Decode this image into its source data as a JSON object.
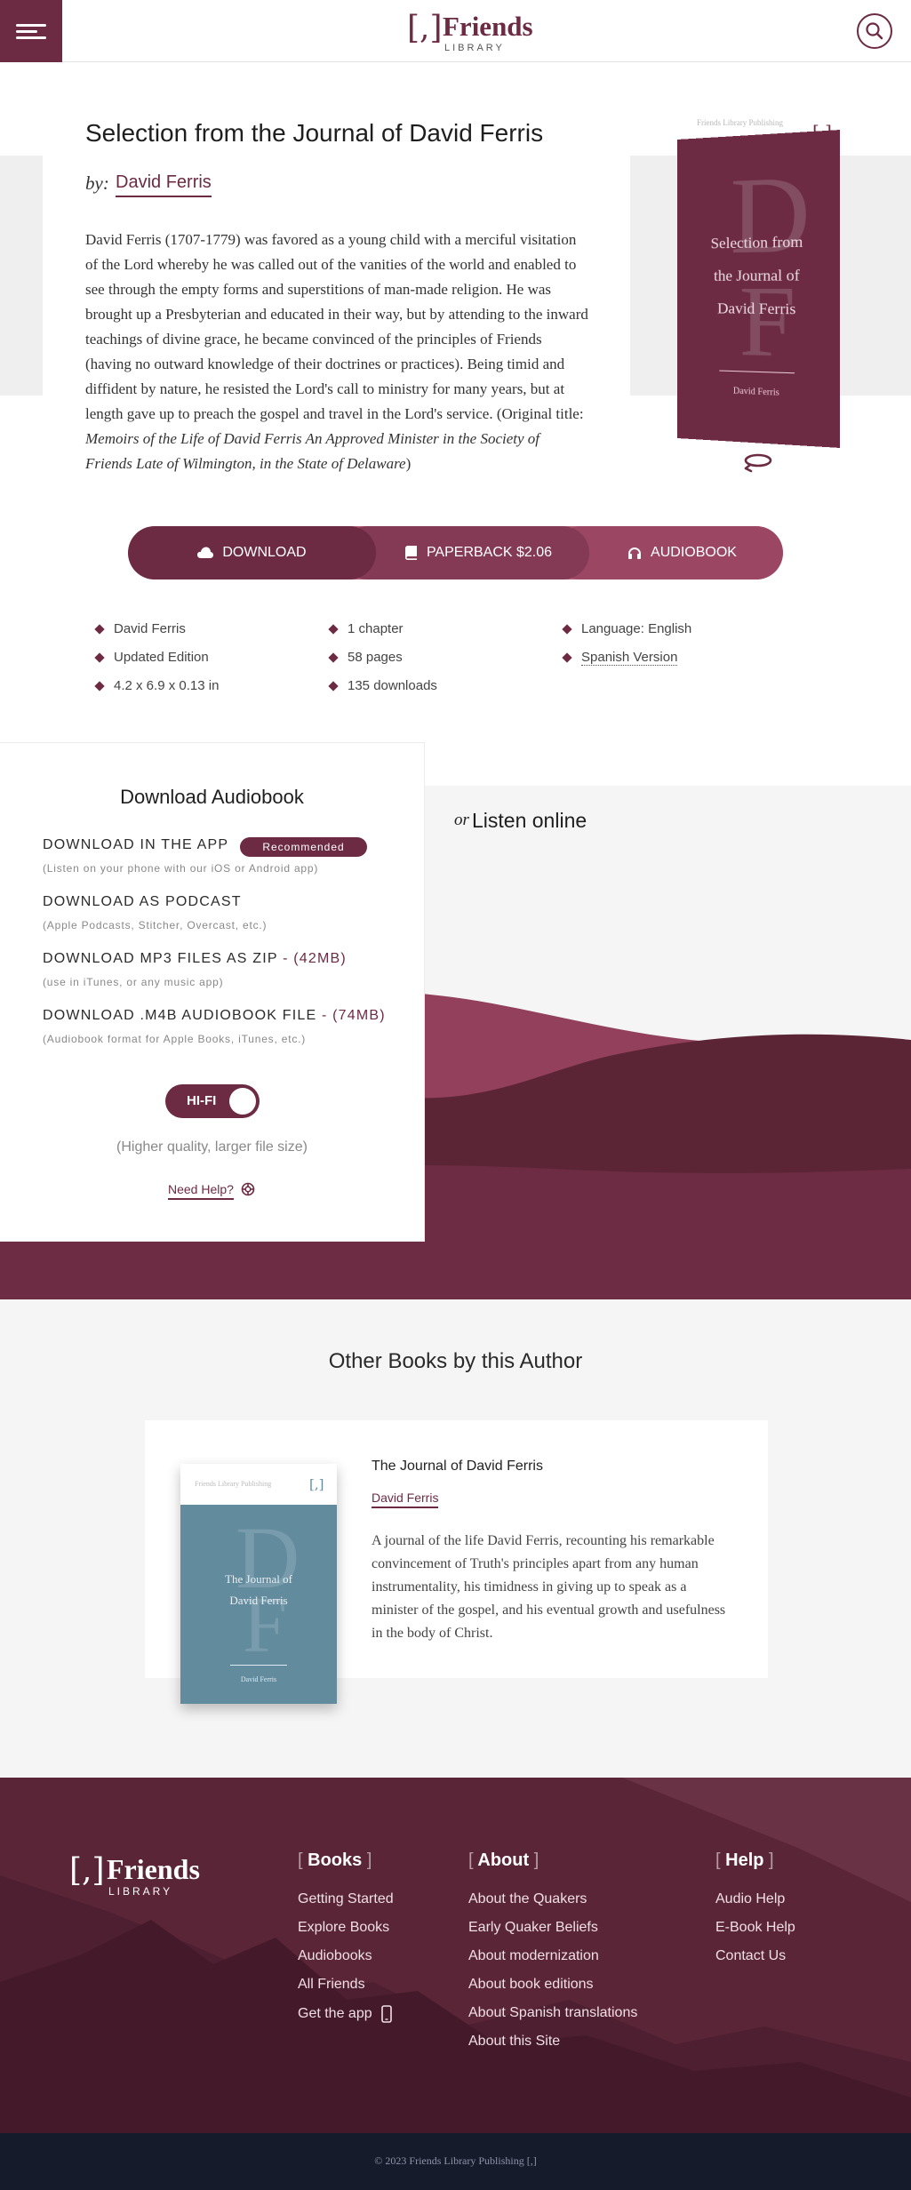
{
  "header": {
    "logo_bracket": "[,]",
    "logo_name": "Friends",
    "logo_sub": "LIBRARY",
    "menu_icon": "hamburger-menu-icon",
    "search_icon": "search-icon"
  },
  "book": {
    "title": "Selection from the Journal of David Ferris",
    "by_label": "by:",
    "author": "David Ferris",
    "description": "David Ferris (1707-1779) was favored as a young child with a merciful visitation of the Lord whereby he was called out of the vanities of the world and enabled to see through the empty forms and superstitions of man-made religion. He was brought up a Presbyterian and educated in their way, but by attending to the inward teachings of divine grace, he became convinced of the principles of Friends (having no outward knowledge of their doctrines or practices). Being timid and diffident by nature, he resisted the Lord's call to ministry for many years, but at length gave up to preach the gospel and travel in the Lord's service. (Original title: ",
    "original_title": "Memoirs of the Life of David Ferris An Approved Minister in the Society of Friends Late of Wilmington, in the State of Delaware",
    "description_end": ")",
    "cover": {
      "publisher": "Friends Library Publishing",
      "logo": "[,]",
      "monogram_1": "D",
      "monogram_2": "F",
      "title_line_1": "Selection from",
      "title_line_2": "the Journal of",
      "title_line_3": "David Ferris",
      "author": "David Ferris",
      "color": "#6c2b43"
    }
  },
  "actions": {
    "download": "DOWNLOAD",
    "paperback": "PAPERBACK $2.06",
    "audiobook": "AUDIOBOOK"
  },
  "meta": {
    "col1": [
      "David Ferris",
      "Updated Edition",
      "4.2 x 6.9 x 0.13 in"
    ],
    "col2": [
      "1 chapter",
      "58 pages",
      "135 downloads"
    ],
    "col3": [
      "Language: English",
      "Spanish Version"
    ]
  },
  "audio": {
    "title": "Download Audiobook",
    "options": [
      {
        "label": "DOWNLOAD IN THE APP",
        "size": "",
        "sub": "(Listen on your phone with our iOS or Android app)"
      },
      {
        "label": "DOWNLOAD AS PODCAST",
        "size": "",
        "sub": "(Apple Podcasts, Stitcher, Overcast, etc.)"
      },
      {
        "label": "DOWNLOAD MP3 FILES AS ZIP",
        "size": "- (42MB)",
        "sub": "(use in iTunes, or any music app)"
      },
      {
        "label": "DOWNLOAD .M4B AUDIOBOOK FILE",
        "size": "- (74MB)",
        "sub": "(Audiobook format for Apple Books, iTunes, etc.)"
      }
    ],
    "recommended": "Recommended",
    "hifi_label": "HI-FI",
    "hifi_note": "(Higher quality, larger file size)",
    "need_help": "Need Help?",
    "listen_or": "or",
    "listen_title": "Listen online"
  },
  "other_books": {
    "heading": "Other Books by this Author",
    "book": {
      "title": "The Journal of David Ferris",
      "author": "David Ferris",
      "description": "A journal of the life David Ferris, recounting his remarkable convincement of Truth's principles apart from any human instrumentality, his timidness in giving up to speak as a minister of the gospel, and his eventual growth and usefulness in the body of Christ.",
      "cover": {
        "publisher": "Friends Library Publishing",
        "logo": "[,]",
        "monogram_1": "D",
        "monogram_2": "F",
        "title_line_1": "The Journal of",
        "title_line_2": "David Ferris",
        "author": "David Ferris",
        "color": "#628b9e"
      }
    }
  },
  "footer": {
    "logo_bracket": "[,]",
    "logo_name": "Friends",
    "logo_sub": "LIBRARY",
    "books_heading": "Books",
    "books": [
      "Getting Started",
      "Explore Books",
      "Audiobooks",
      "All Friends",
      "Get the app"
    ],
    "about_heading": "About",
    "about": [
      "About the Quakers",
      "Early Quaker Beliefs",
      "About modernization",
      "About book editions",
      "About Spanish translations",
      "About this Site"
    ],
    "help_heading": "Help",
    "help": [
      "Audio Help",
      "E-Book Help",
      "Contact Us"
    ],
    "copyright": "© 2023 Friends Library Publishing [,]"
  },
  "colors": {
    "brand": "#6c2b43",
    "footer_bar": "#161b2c"
  }
}
